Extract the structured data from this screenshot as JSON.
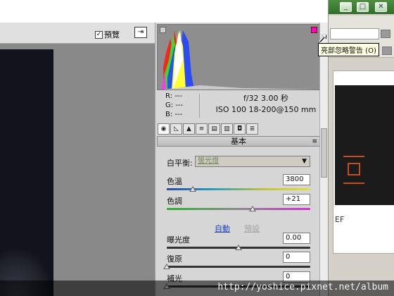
{
  "toolbar": {
    "preview_label": "預覽",
    "preview_checked": true
  },
  "tooltip": "亮部忽略警告 (O)",
  "readout": {
    "r": "R:  ---",
    "g": "G:  ---",
    "b": "B:  ---",
    "aperture_shutter": "f/32   3.00 秒",
    "iso_lens": "ISO 100   18-200@150 mm"
  },
  "tabs": [
    "◉",
    "◺",
    "▲",
    "≡",
    "▤",
    "▥",
    "◘",
    "≣"
  ],
  "section": {
    "title": "基本",
    "menu_icon": "≡"
  },
  "white_balance": {
    "label": "白平衡:",
    "value": "螢光燈"
  },
  "sliders": {
    "temperature": {
      "label": "色溫",
      "value": "3800",
      "position": 0.18
    },
    "tint": {
      "label": "色調",
      "value": "+21",
      "position": 0.6
    },
    "exposure": {
      "label": "曝光度",
      "value": "0.00",
      "position": 0.5
    },
    "recovery": {
      "label": "復原",
      "value": "0",
      "position": 0.0
    },
    "fill_light": {
      "label": "補光",
      "value": "0",
      "position": 0.0
    }
  },
  "links": {
    "auto": "自動",
    "default": "預設"
  },
  "background_app": {
    "filename": "EF"
  },
  "watermark": "http://yoshice.pixnet.net/album",
  "colors": {
    "accent": "#1f45b9",
    "clip_warning": "#ff00cc",
    "titlebar_green": "#3f7f35"
  }
}
